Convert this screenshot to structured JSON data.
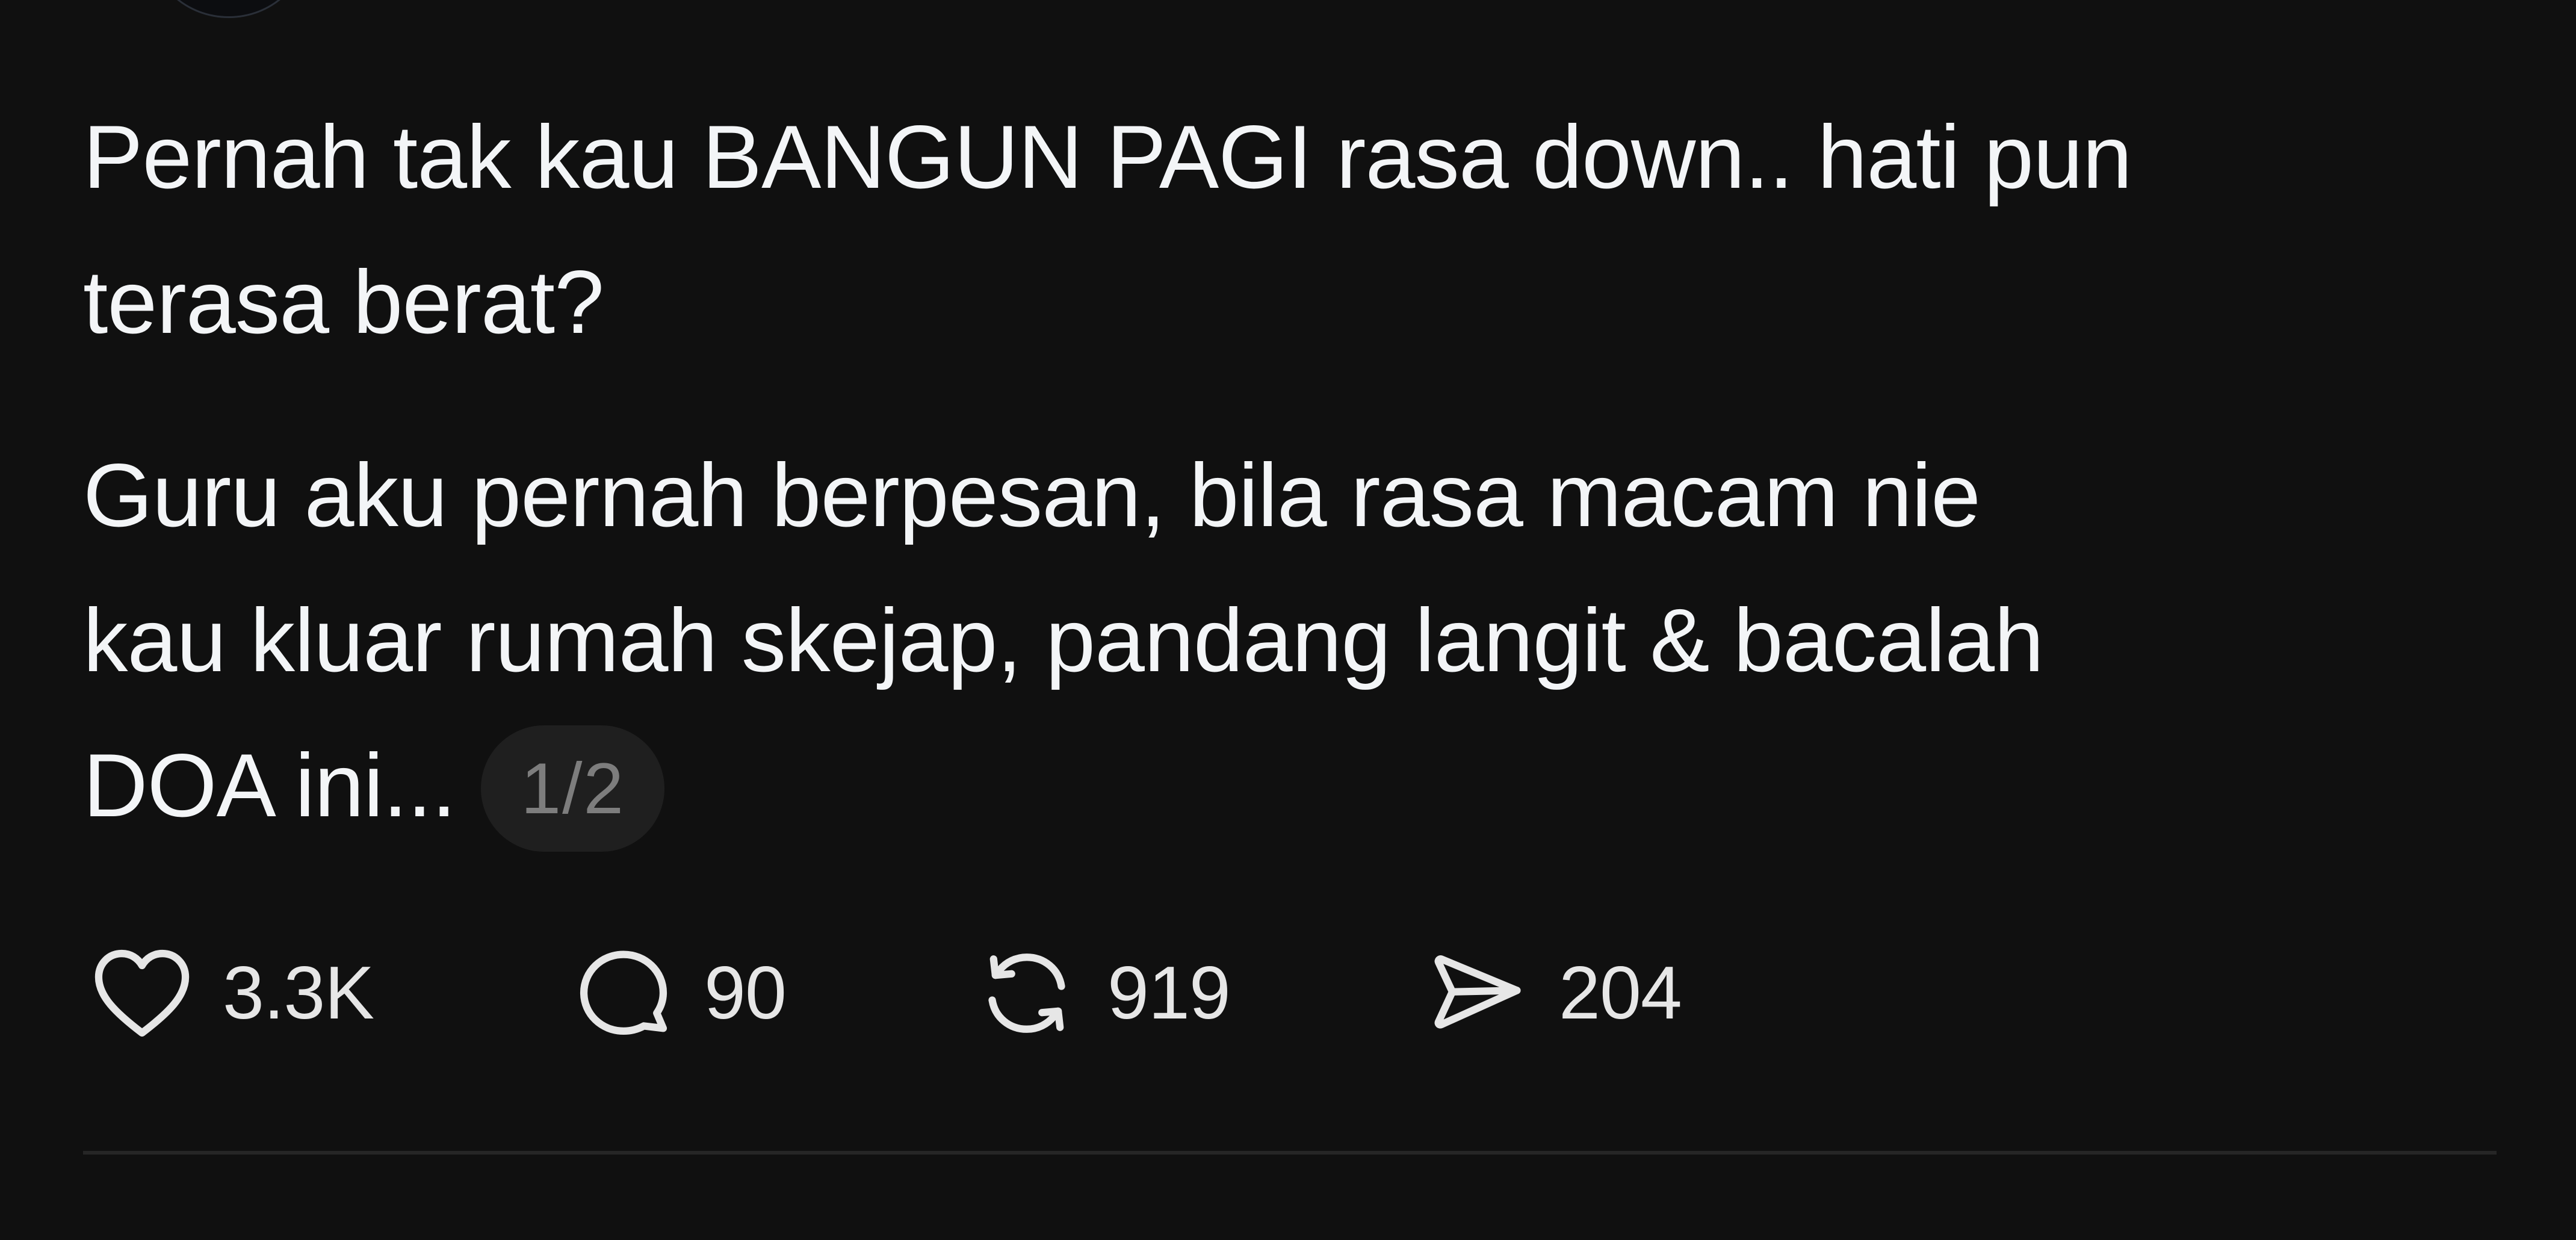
{
  "post": {
    "paragraphs": [
      {
        "lines": [
          "Pernah tak kau BANGUN PAGI rasa down.. hati pun",
          "terasa berat?"
        ]
      },
      {
        "lines": [
          "Guru aku pernah berpesan, bila rasa macam nie",
          "kau kluar rumah skejap, pandang langit & bacalah",
          "DOA ini..."
        ]
      }
    ],
    "page_counter": "1/2"
  },
  "actions": {
    "like": {
      "icon": "heart-icon",
      "count": "3.3K"
    },
    "reply": {
      "icon": "speech-bubble-icon",
      "count": "90"
    },
    "repost": {
      "icon": "repost-arrows-icon",
      "count": "919"
    },
    "share": {
      "icon": "send-arrow-icon",
      "count": "204"
    }
  },
  "colors": {
    "background": "#101010",
    "text": "#f3f5f7",
    "muted": "#7d7d7d",
    "badge_bg": "#1f1f1f",
    "divider": "#262626"
  }
}
